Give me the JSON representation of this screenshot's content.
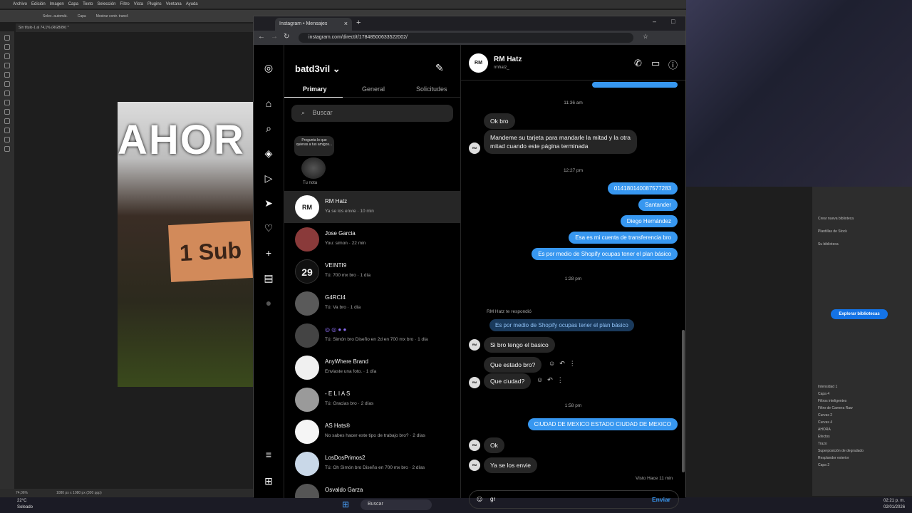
{
  "photoshop": {
    "menu": [
      "Archivo",
      "Edición",
      "Imagen",
      "Capa",
      "Texto",
      "Selección",
      "Filtro",
      "Vista",
      "Plugins",
      "Ventana",
      "Ayuda"
    ],
    "options": [
      "Selec. automát.",
      "Capa",
      "Mostrar contr. transf."
    ],
    "doc_tab": "Sin título-1 al 74,1% (RGB/8#) *",
    "canvas_title": "AHOR",
    "canvas_sub": "1 Sub",
    "zoom": "74,06%",
    "doc_size": "1080 px x 1080 px (300 ppp)",
    "library_items": [
      "Crear nueva biblioteca",
      "Plantillas de Stock",
      "Su biblioteca"
    ],
    "explore_button": "Explorar bibliotecas",
    "layers": [
      "Intensidad 1",
      "Capa 4",
      "Filtros inteligentes",
      "Filtro de Camera Raw",
      "Curvas 2",
      "Curvas 4",
      "AHORA",
      "Efectos",
      "Trazo",
      "Superposición de degradado",
      "Resplandor exterior",
      "Capa 2"
    ]
  },
  "taskbar": {
    "weather_temp": "22°C",
    "weather_desc": "Soleado",
    "search": "Buscar",
    "time": "02:21 p. m.",
    "date": "02/01/2026"
  },
  "browser": {
    "tab_title": "Instagram • Mensajes",
    "url": "instagram.com/direct/t/17848500633522002/"
  },
  "inbox": {
    "username": "batd3vil",
    "tabs": {
      "primary": "Primary",
      "general": "General",
      "requests": "Solicitudes"
    },
    "search_placeholder": "Buscar",
    "note_text": "Pregunta lo que quieras a tus amigos...",
    "note_label": "Tu nota",
    "conversations": [
      {
        "name": "RM Hatz",
        "preview": "Ya se los envie · 10 min",
        "avatar": "RM"
      },
      {
        "name": "Jose Garcia",
        "preview": "You: simon · 22 min",
        "avatar": ""
      },
      {
        "name": "VEINTI9",
        "preview": "Tú: 700 mx bro · 1 día",
        "avatar": "29"
      },
      {
        "name": "G4RCI4",
        "preview": "Tú: Va bro · 1 día",
        "avatar": ""
      },
      {
        "name": "",
        "preview": "Tú: Simón bro Diseño en 2d en 700 mx bro · 1 día",
        "avatar": ""
      },
      {
        "name": "AnyWhere Brand",
        "preview": "Enviaste una foto. · 1 día",
        "avatar": ""
      },
      {
        "name": "- E L I A S",
        "preview": "Tú: Gracias bro · 2 días",
        "avatar": ""
      },
      {
        "name": "AS Hats®",
        "preview": "No sabes hacer este tipo de trabajo bro? · 2 días",
        "avatar": ""
      },
      {
        "name": "LosDosPrimos2",
        "preview": "Tú: Oh Simón bro Diseño en 700 mx bro · 2 días",
        "avatar": ""
      },
      {
        "name": "Osvaldo Garza",
        "preview": "",
        "avatar": ""
      }
    ]
  },
  "chat": {
    "name": "RM Hatz",
    "handle": "rmhatz_",
    "ts1": "11:36 am",
    "in1": "Ok bro",
    "in2": "Mandeme su tarjeta para mandarle la mitad y la otra mitad cuando este página terminada",
    "ts2": "12:27 pm",
    "out1": "014180140087577283",
    "out2": "Santander",
    "out3": "Diego Hernández",
    "out4": "Esa es mi cuenta de transferencia bro",
    "out5": "Es por medio de Shopify ocupas tener el plan básico",
    "ts3": "1:28 pm",
    "reply_label": "RM Hatz te respondió",
    "reply_quote": "Es por medio de Shopify ocupas tener el plan básico",
    "in3": "Si bro tengo el basico",
    "in4": "Que estado bro?",
    "in5": "Que ciudad?",
    "ts4": "1:58 pm",
    "out6": "CIUDAD DE MEXICO ESTADO CIUDAD DE MEXICO",
    "in6": "Ok",
    "in7": "Ya se los envie",
    "seen": "Visto Hace 11 min",
    "composer_text": "gr",
    "send": "Enviar"
  }
}
